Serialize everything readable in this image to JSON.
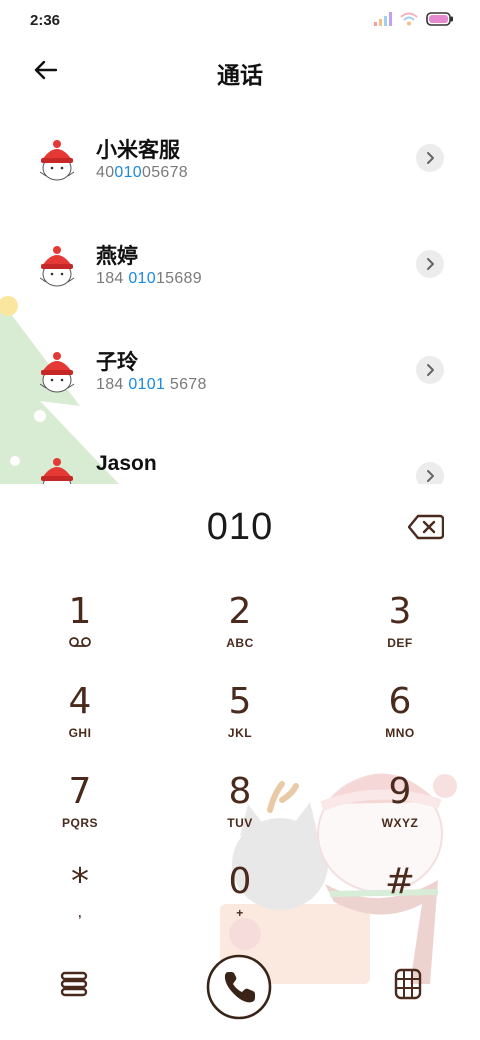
{
  "status_bar": {
    "time": "2:36"
  },
  "header": {
    "title": "通话"
  },
  "contacts": [
    {
      "name": "小米客服",
      "num_pre": "40",
      "num_hl": "010",
      "num_post": "05678"
    },
    {
      "name": "燕婷",
      "num_pre": "184 ",
      "num_hl": "010",
      "num_post": "15689"
    },
    {
      "name": "子玲",
      "num_pre": "184 ",
      "num_hl": "0101",
      "num_post": " 5678"
    },
    {
      "name": "Jason",
      "num_pre": "",
      "num_hl": "",
      "num_post": ""
    }
  ],
  "dialer": {
    "input": "010",
    "keys": [
      {
        "digit": "1",
        "letters": ""
      },
      {
        "digit": "2",
        "letters": "ABC"
      },
      {
        "digit": "3",
        "letters": "DEF"
      },
      {
        "digit": "4",
        "letters": "GHI"
      },
      {
        "digit": "5",
        "letters": "JKL"
      },
      {
        "digit": "6",
        "letters": "MNO"
      },
      {
        "digit": "7",
        "letters": "PQRS"
      },
      {
        "digit": "8",
        "letters": "TUV"
      },
      {
        "digit": "9",
        "letters": "WXYZ"
      },
      {
        "digit": "*",
        "letters": ","
      },
      {
        "digit": "0",
        "letters": "+"
      },
      {
        "digit": "#",
        "letters": ""
      }
    ]
  },
  "colors": {
    "key_text": "#4a2a1c",
    "highlight": "#1a8ae5",
    "tree": "#d7ecd2"
  },
  "icons": [
    "back-arrow-icon",
    "chevron-right-icon",
    "backspace-icon",
    "voicemail-icon",
    "menu-icon",
    "phone-icon",
    "dialpad-icon"
  ]
}
